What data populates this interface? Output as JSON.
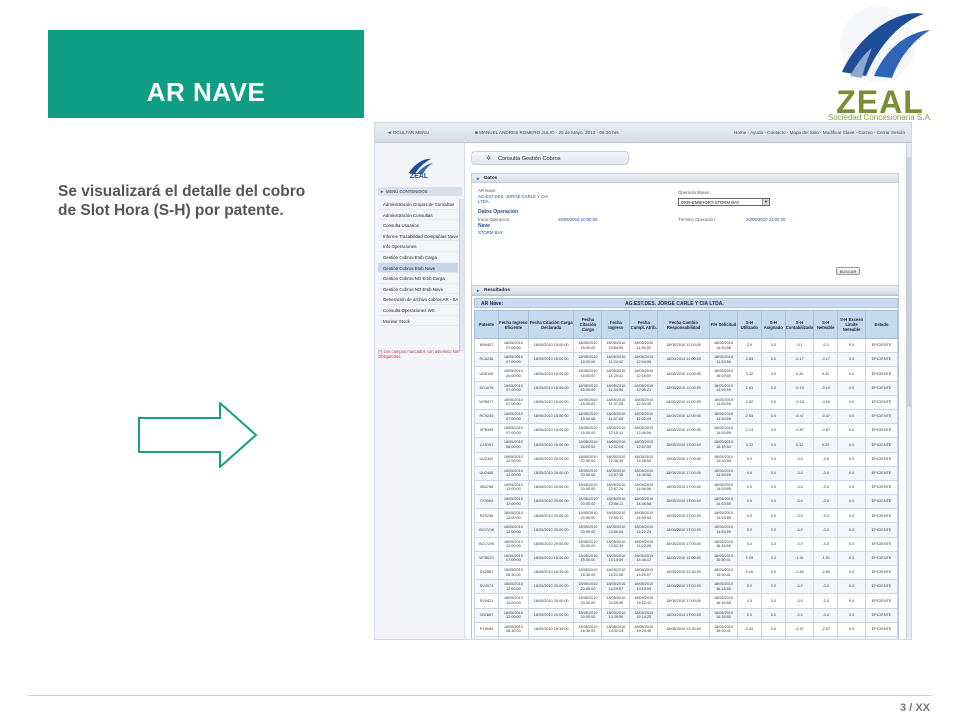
{
  "slide": {
    "title": "AR NAVE",
    "description": "Se visualizará el detalle del cobro de Slot Hora (S-H) por patente.",
    "page_number": "3 / XX",
    "logo": {
      "word": "ZEAL",
      "subtitle": "Sociedad Concesionaria S.A.",
      "colors": {
        "blue": "#1f4e99",
        "green": "#7a8e33"
      }
    },
    "accent_color": "#0f9e83"
  },
  "app": {
    "topbar": {
      "hide_menu": "◄ OCULTAR MENU",
      "user_info": "■ MANUEL ANDRES ROMERO JULIO - 25 de Mayo, 2010 - 09:30 hrs.",
      "nav_links": "Home - Ayuda - Contacto - Mapa del Sitio - Modificar Clave - Correo - Cerrar Sesión"
    },
    "sidebar": {
      "logo_text": "ZEAL",
      "menu_header": "MENÚ CONTENIDOS",
      "items": [
        "Administración Grupos de Consultas",
        "Administración Consultas",
        "Consulta Usuarios",
        "Informe Trazabilidad Compañías Navieras",
        "Info Operaciones",
        "Gestión Cobros Emb Carga",
        "Gestión Cobros Emb Nave",
        "Gestión Cobros NO Emb Carga",
        "Gestión Cobros NO Emb Nave",
        "Generación de archivo cobros AR - SAP",
        "Consulta Operaciones WS",
        "Monitor Stock"
      ],
      "active_index": 6,
      "required_note": "(*) Los campos marcados con asterisco son Obligatorios."
    },
    "page_title": "Consulta Gestión Cobros",
    "datos": {
      "header": "Datos",
      "ar_nave_label": "AR-Nave:",
      "ar_nave_value": "AG.EST.DES. JORGE CARLE Y CIA LTDA.",
      "operacion_label": "Operación/Nave:",
      "operacion_value": "0939-EMBHORT-STORM BAY",
      "datos_operacion": "Datos Operación",
      "inicio_label": "Inicio Operación:",
      "inicio_value": "18/05/2010 10:00:00",
      "termino_label": "Término Operación:",
      "termino_value": "20/05/2010 23:00:00",
      "nave_label": "Nave",
      "nave_value": "STORM BAY",
      "search_button": "BUSCAR"
    },
    "resultados": {
      "header": "Resultados",
      "ar_nave_key": "AR Nave:",
      "ar_nave_value": "AG.EST.DES. JORGE CARLE Y CIA LTDA.",
      "columns": [
        "Patente",
        "Fecha Ingreso Eficiente",
        "Fecha Citación Carga Declarada",
        "Fecha Citación Carga",
        "Fecha Ingreso",
        "Fecha Cumpl. Atrib.",
        "Fecha Cambio Responsabilidad",
        "F/H Solicitud",
        "S-H Utilizado",
        "S-H Asignado",
        "S-H Contabilizado",
        "S-H Neteable",
        "S-H Exceso Límite Neteable",
        "Estado"
      ],
      "rows": [
        [
          "NB9407",
          "18/05/2010\n07:00:00",
          "18/05/2010 15:00:00",
          "18/05/2010\n15:00:00",
          "18/05/2010\n10:54:09",
          "18/05/2010\n11:35:50",
          "18/05/2010 12:00:00",
          "18/05/2010\n14:53:56",
          "2.9",
          "3.0",
          "-0.1",
          "-0.1",
          "0.0",
          "EFICIENTE"
        ],
        [
          "RC8236",
          "18/05/2010\n07:00:00",
          "18/05/2010 15:00:00",
          "18/05/2010\n15:00:00",
          "18/05/2010\n11:24:42",
          "18/05/2010\n12:04:05",
          "18/05/2010 12:00:00",
          "18/05/2010\n14:53:59",
          "2.83",
          "3.0",
          "-0.17",
          "-0.17",
          "0.0",
          "EFICIENTE"
        ],
        [
          "UD6169",
          "18/05/2010\n20:00:00",
          "18/05/2010 16:00:00",
          "18/05/2010\n16:00:00",
          "18/05/2010\n11:29:41",
          "18/05/2010\n12:16:09",
          "18/05/2010 13:00:00",
          "18/05/2010\n16:19:55",
          "3.32",
          "3.0",
          "0.32",
          "0.32",
          "0.0",
          "EFICIENTE"
        ],
        [
          "SG1676",
          "18/05/2010\n07:00:00",
          "18/05/2010 15:00:00",
          "18/05/2010\n15:00:00",
          "18/05/2010\n11:34:54",
          "18/05/2010\n12:05:21",
          "18/05/2010 12:00:00",
          "18/05/2010\n14:53:59",
          "2.81",
          "3.0",
          "-0.19",
          "-0.19",
          "0.0",
          "EFICIENTE"
        ],
        [
          "WT8677",
          "18/05/2010\n07:00:00",
          "18/05/2010 15:00:00",
          "18/05/2010\n15:00:00",
          "18/05/2010\n11:37:05",
          "18/05/2010\n12:04:45",
          "18/05/2010 12:00:00",
          "18/05/2010\n14:53:59",
          "2.82",
          "3.0",
          "-0.18",
          "-0.18",
          "0.0",
          "EFICIENTE"
        ],
        [
          "RC9240",
          "18/05/2010\n07:00:00",
          "18/05/2010 15:00:00",
          "18/05/2010\n15:00:00",
          "18/05/2010\n11:47:06",
          "18/05/2010\n12:22:09",
          "18/05/2010 12:00:00",
          "18/05/2010\n14:53:59",
          "2.53",
          "3.0",
          "-0.47",
          "-0.47",
          "0.0",
          "EFICIENTE"
        ],
        [
          "XP8395",
          "18/05/2010\n07:00:00",
          "18/05/2010 15:00:00",
          "18/05/2010\n15:00:00",
          "18/05/2010\n12:15:12",
          "18/05/2010\n12:46:54",
          "18/05/2010 12:00:00",
          "18/05/2010\n14:53:59",
          "2.13",
          "3.0",
          "-0.87",
          "-0.87",
          "0.0",
          "EFICIENTE"
        ],
        [
          "CJJD51",
          "18/05/2010\n08:00:00",
          "18/05/2010 16:00:00",
          "18/05/2010\n16:00:00",
          "18/05/2010\n12:32:04",
          "18/05/2010\n12:57:59",
          "18/05/2010 13:00:00",
          "18/05/2010\n16:19:54",
          "3.32",
          "3.0",
          "0.32",
          "0.32",
          "0.0",
          "EFICIENTE"
        ],
        [
          "UU2461",
          "18/05/2010\n12:00:00",
          "18/05/2010 20:00:00",
          "18/05/2010\n20:00:00",
          "18/05/2010\n12:36:39",
          "18/05/2010\n14:46:50",
          "18/05/2010 17:00:00",
          "18/05/2010\n14:53:59",
          "0.0",
          "3.0",
          "-3.0",
          "-3.0",
          "0.0",
          "EFICIENTE"
        ],
        [
          "UU2465",
          "18/05/2010\n12:00:00",
          "18/05/2010 20:00:00",
          "18/05/2010\n20:00:00",
          "18/05/2010\n12:57:15",
          "18/05/2010\n14:46:52",
          "18/05/2010 17:00:00",
          "18/05/2010\n14:53:59",
          "0.0",
          "3.0",
          "-3.0",
          "-3.0",
          "0.0",
          "EFICIENTE"
        ],
        [
          "VB4766",
          "18/05/2010\n12:00:00",
          "18/05/2010 20:00:00",
          "18/05/2010\n20:00:00",
          "18/05/2010\n12:57:24",
          "18/05/2010\n14:46:56",
          "18/05/2010 17:00:00",
          "18/05/2010\n14:53:59",
          "0.0",
          "3.0",
          "-3.0",
          "-3.0",
          "0.0",
          "EFICIENTE"
        ],
        [
          "TX3063",
          "18/05/2010\n12:00:00",
          "18/05/2010 20:00:00",
          "18/05/2010\n20:00:00",
          "18/05/2010\n12:58:11",
          "18/05/2010\n14:46:58",
          "18/05/2010 17:00:00",
          "18/05/2010\n14:53:59",
          "0.0",
          "3.0",
          "-3.0",
          "-3.0",
          "0.0",
          "EFICIENTE"
        ],
        [
          "RZ5298",
          "18/05/2010\n12:00:00",
          "18/05/2010 20:00:00",
          "18/05/2010\n20:00:00",
          "18/05/2010\n12:59:11",
          "18/05/2010\n14:49:54",
          "18/05/2010 17:00:00",
          "18/05/2010\n14:53:59",
          "0.0",
          "3.0",
          "-3.0",
          "-3.0",
          "0.0",
          "EFICIENTE"
        ],
        [
          "BCCV48",
          "18/05/2010\n12:00:00",
          "18/05/2010 20:00:00",
          "18/05/2010\n20:00:00",
          "18/05/2010\n13:50:04",
          "18/05/2010\n14:22:24",
          "18/05/2010 17:00:00",
          "18/05/2010\n14:53:59",
          "0.0",
          "3.0",
          "-3.0",
          "-3.0",
          "0.0",
          "EFICIENTE"
        ],
        [
          "BCCV49",
          "18/05/2010\n12:00:00",
          "18/05/2010 20:00:00",
          "18/05/2010\n20:00:00",
          "18/05/2010\n13:52:39",
          "18/05/2010\n14:22:28",
          "18/05/2010 17:00:00",
          "18/05/2010\n16:18:55",
          "0.0",
          "3.0",
          "-3.0",
          "-3.0",
          "0.0",
          "EFICIENTE"
        ],
        [
          "WT8679",
          "18/05/2010\n07:00:00",
          "18/05/2010 15:00:00",
          "18/05/2010\n15:00:00",
          "18/05/2010\n14:10:09",
          "18/05/2010\n14:46:12",
          "18/05/2010 12:00:00",
          "18/05/2010\n15:50:41",
          "1.09",
          "3.0",
          "-1.91",
          "-1.91",
          "0.0",
          "EFICIENTE"
        ],
        [
          "DX2887",
          "18/05/2010\n06:30:00",
          "18/05/2010 16:30:00",
          "18/05/2010\n16:30:00",
          "18/05/2010\n14:22:06",
          "18/05/2010\n15:29:07",
          "18/05/2010 13:30:00",
          "18/05/2010\n15:50:41",
          "0.16",
          "3.0",
          "-2.84",
          "-2.84",
          "0.0",
          "EFICIENTE"
        ],
        [
          "SV4974",
          "18/05/2010\n12:00:00",
          "18/05/2010 20:00:00",
          "18/05/2010\n20:00:00",
          "18/05/2010\n14:29:57",
          "18/05/2010\n15:13:09",
          "18/05/2010 17:00:00",
          "18/05/2010\n16:18:55",
          "0.0",
          "3.0",
          "-3.0",
          "-3.0",
          "0.0",
          "EFICIENTE"
        ],
        [
          "SV4421",
          "18/05/2010\n12:00:00",
          "18/05/2010 20:00:00",
          "18/05/2010\n20:00:00",
          "18/05/2010\n14:29:46",
          "18/05/2010\n15:12:42",
          "18/05/2010 17:00:00",
          "18/05/2010\n16:18:55",
          "0.0",
          "3.0",
          "-3.0",
          "-3.0",
          "0.0",
          "EFICIENTE"
        ],
        [
          "XB7667",
          "18/05/2010\n12:00:00",
          "18/05/2010 20:00:00",
          "18/05/2010\n20:00:00",
          "18/05/2010\n14:29:59",
          "18/05/2010\n15:14:25",
          "18/05/2010 17:00:00",
          "18/05/2010\n16:18:55",
          "0.0",
          "3.0",
          "-3.0",
          "-3.0",
          "0.0",
          "EFICIENTE"
        ],
        [
          "FY8085",
          "18/05/2010\n08:30:00",
          "18/05/2010 16:30:00",
          "18/05/2010\n16:30:00",
          "18/05/2010\n14:32:25",
          "18/05/2010\n15:24:46",
          "18/05/2010 13:30:00",
          "18/05/2010\n15:50:41",
          "0.43",
          "3.0",
          "-2.57",
          "-2.57",
          "0.0",
          "EFICIENTE"
        ],
        [
          "KB6840",
          "18/05/2010\n08:00:00",
          "18/05/2010 16:00:00",
          "18/05/2010\n16:00:00",
          "18/05/2010\n14:12:13",
          "18/05/2010\n15:18:39",
          "18/05/2010 13:00:00",
          "18/05/2010\n15:50:41",
          "0.4",
          "3.0",
          "-2.6",
          "-2.6",
          "0.0",
          "EFICIENTE"
        ]
      ]
    }
  }
}
